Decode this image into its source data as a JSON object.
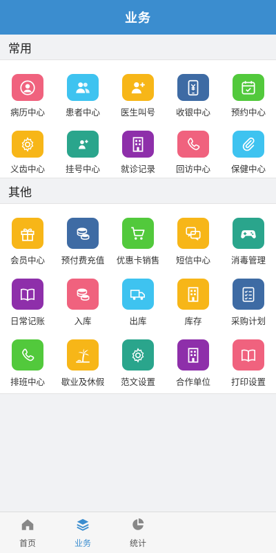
{
  "header": {
    "title": "业务"
  },
  "sections": {
    "common": {
      "title": "常用",
      "items": [
        {
          "label": "病历中心",
          "icon": "person-circle",
          "color": "#f0627e"
        },
        {
          "label": "患者中心",
          "icon": "users",
          "color": "#3ec3f0"
        },
        {
          "label": "医生叫号",
          "icon": "person-plus",
          "color": "#f7b618"
        },
        {
          "label": "收银中心",
          "icon": "phone-yen",
          "color": "#3e6ba4"
        },
        {
          "label": "预约中心",
          "icon": "calendar",
          "color": "#52c93c"
        },
        {
          "label": "义齿中心",
          "icon": "gear",
          "color": "#f7b618"
        },
        {
          "label": "挂号中心",
          "icon": "person-plus-small",
          "color": "#2aa58c"
        },
        {
          "label": "就诊记录",
          "icon": "building",
          "color": "#8e2faa"
        },
        {
          "label": "回访中心",
          "icon": "phone",
          "color": "#f0627e"
        },
        {
          "label": "保健中心",
          "icon": "paperclip",
          "color": "#3ec3f0"
        }
      ]
    },
    "other": {
      "title": "其他",
      "items": [
        {
          "label": "会员中心",
          "icon": "gift",
          "color": "#f7b618"
        },
        {
          "label": "预付费充值",
          "icon": "coins",
          "color": "#3e6ba4"
        },
        {
          "label": "优惠卡销售",
          "icon": "cart",
          "color": "#52c93c"
        },
        {
          "label": "短信中心",
          "icon": "chat",
          "color": "#f7b618"
        },
        {
          "label": "消毒管理",
          "icon": "gamepad",
          "color": "#2aa58c"
        },
        {
          "label": "日常记账",
          "icon": "book",
          "color": "#8e2faa"
        },
        {
          "label": "入库",
          "icon": "coins",
          "color": "#f0627e"
        },
        {
          "label": "出库",
          "icon": "truck",
          "color": "#3ec3f0"
        },
        {
          "label": "库存",
          "icon": "building",
          "color": "#f7b618"
        },
        {
          "label": "采购计划",
          "icon": "checklist",
          "color": "#3e6ba4"
        },
        {
          "label": "排班中心",
          "icon": "phone",
          "color": "#52c93c"
        },
        {
          "label": "歇业及休假",
          "icon": "palm",
          "color": "#f7b618"
        },
        {
          "label": "范文设置",
          "icon": "gear",
          "color": "#2aa58c"
        },
        {
          "label": "合作单位",
          "icon": "building",
          "color": "#8e2faa"
        },
        {
          "label": "打印设置",
          "icon": "book",
          "color": "#f0627e"
        }
      ]
    }
  },
  "tabbar": {
    "items": [
      {
        "label": "首页",
        "icon": "home",
        "active": false
      },
      {
        "label": "业务",
        "icon": "layers",
        "active": true
      },
      {
        "label": "统计",
        "icon": "pie-chart",
        "active": false
      }
    ],
    "active_color": "#3b8dcf",
    "inactive_color": "#666666"
  }
}
